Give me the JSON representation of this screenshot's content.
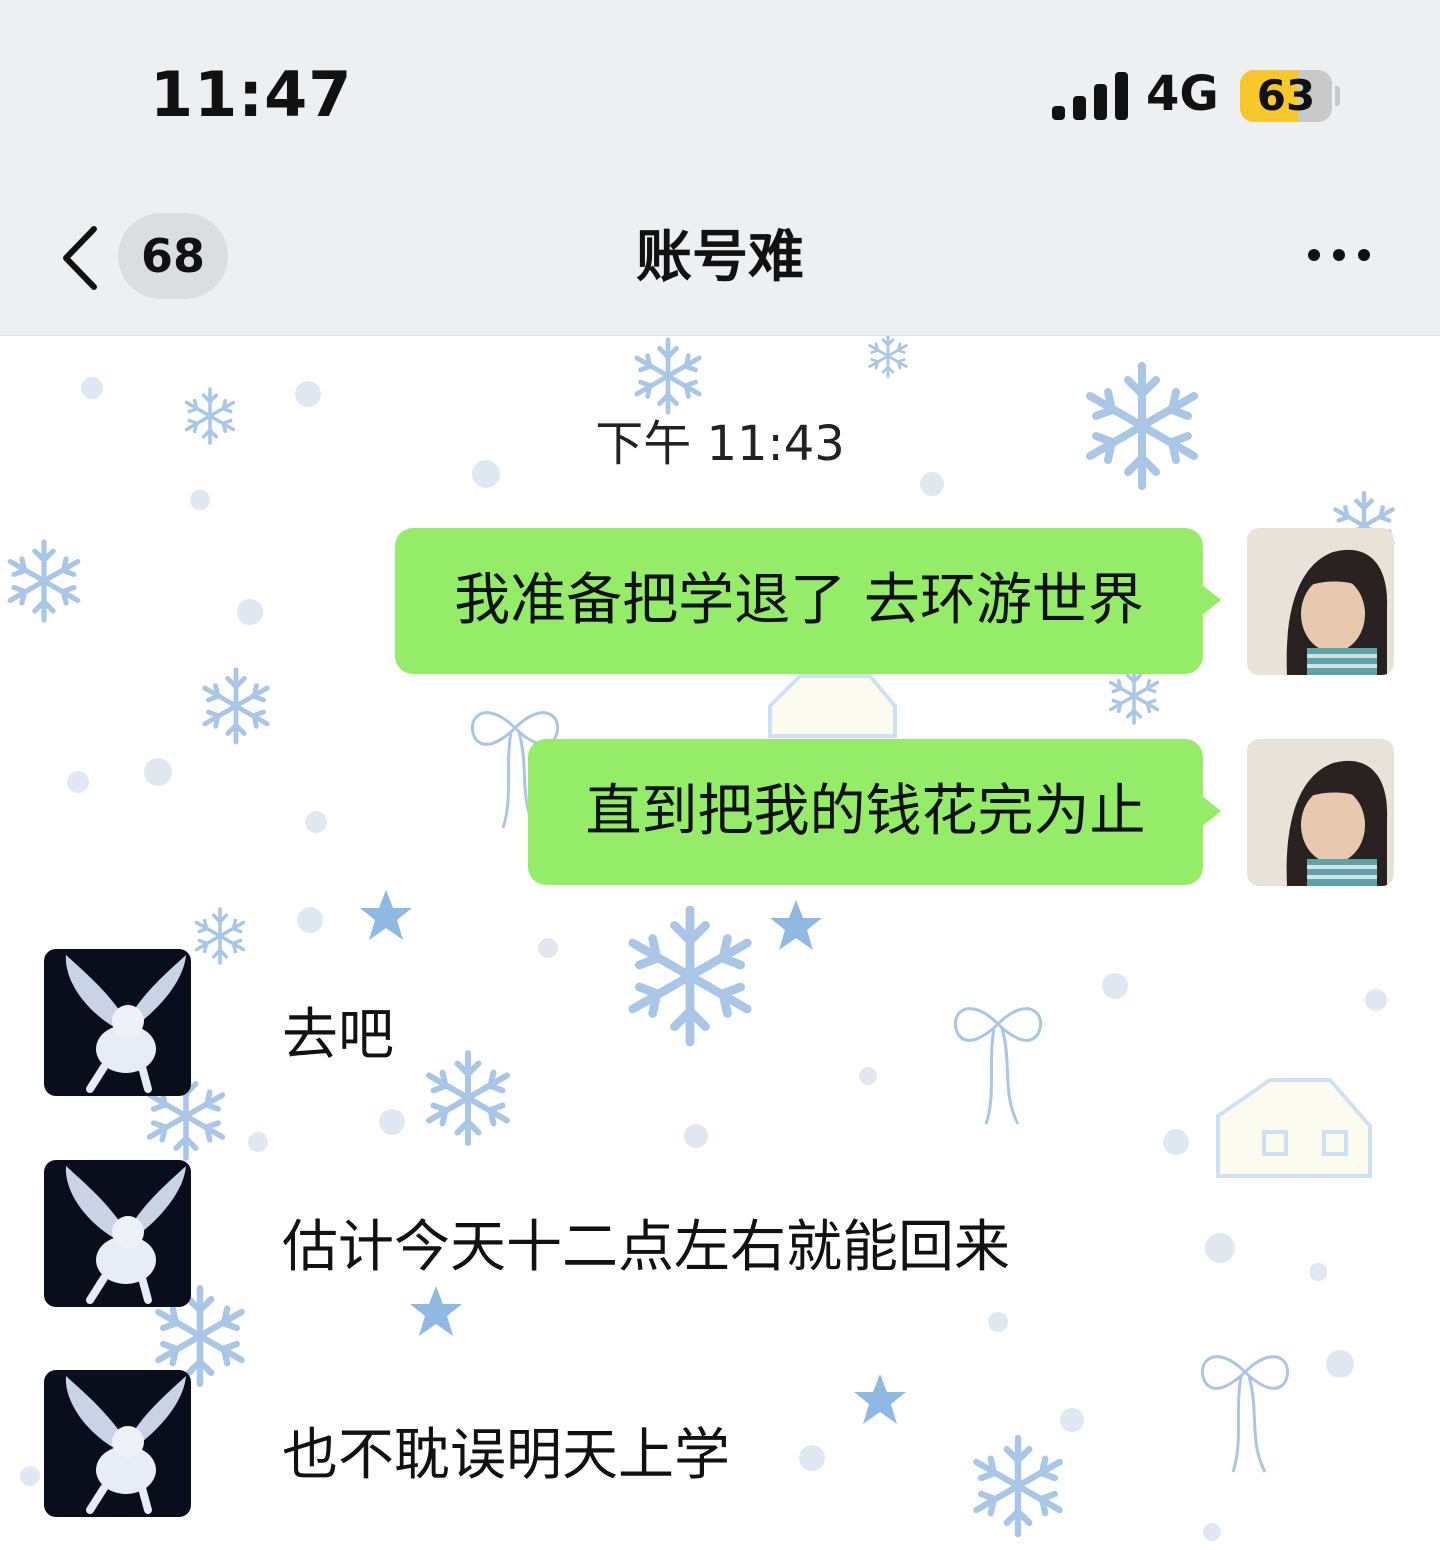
{
  "status_bar": {
    "time": "11:47",
    "network": "4G",
    "battery": "63",
    "battery_level": 0.63,
    "signal_bars": 4
  },
  "nav": {
    "unread_count": "68",
    "title": "账号难"
  },
  "chat": {
    "timestamp": "下午 11:43",
    "outgoing": [
      {
        "text": "我准备把学退了 去环游世界"
      },
      {
        "text": "直到把我的钱花完为止"
      }
    ],
    "incoming": [
      {
        "text": "去吧"
      },
      {
        "text": "估计今天十二点左右就能回来"
      },
      {
        "text": "也不耽误明天上学"
      }
    ]
  },
  "colors": {
    "outgoing_bubble": "#95ec69",
    "header_bg": "#eeeff1",
    "battery_fill": "#f7c82b",
    "wallpaper_motif": "#a9c6e6"
  },
  "icons": [
    "back-chevron-icon",
    "more-icon",
    "signal-icon",
    "battery-icon"
  ]
}
